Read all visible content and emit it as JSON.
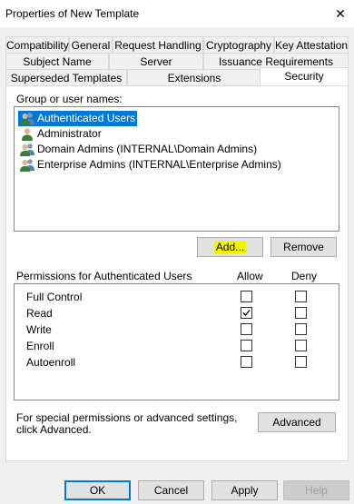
{
  "window": {
    "title": "Properties of New Template",
    "close_glyph": "✕"
  },
  "tabs": {
    "row1": [
      "Compatibility",
      "General",
      "Request Handling",
      "Cryptography",
      "Key Attestation"
    ],
    "row2": [
      "Subject Name",
      "Server",
      "Issuance Requirements"
    ],
    "row3": [
      "Superseded Templates",
      "Extensions",
      "Security"
    ],
    "active": "Security"
  },
  "security": {
    "group_label": "Group or user names:",
    "users": [
      {
        "name": "Authenticated Users",
        "icon": "users-group-icon",
        "selected": true
      },
      {
        "name": "Administrator",
        "icon": "user-icon",
        "selected": false
      },
      {
        "name": "Domain Admins (INTERNAL\\Domain Admins)",
        "icon": "users-group-icon",
        "selected": false
      },
      {
        "name": "Enterprise Admins (INTERNAL\\Enterprise Admins)",
        "icon": "users-group-icon",
        "selected": false
      }
    ],
    "add_label": "Add...",
    "remove_label": "Remove",
    "permissions_label": "Permissions for Authenticated Users",
    "allow_header": "Allow",
    "deny_header": "Deny",
    "permissions": [
      {
        "name": "Full Control",
        "allow": false,
        "deny": false
      },
      {
        "name": "Read",
        "allow": true,
        "deny": false
      },
      {
        "name": "Write",
        "allow": false,
        "deny": false
      },
      {
        "name": "Enroll",
        "allow": false,
        "deny": false
      },
      {
        "name": "Autoenroll",
        "allow": false,
        "deny": false
      }
    ],
    "advanced_text": "For special permissions or advanced settings, click Advanced.",
    "advanced_label": "Advanced"
  },
  "footer": {
    "ok": "OK",
    "cancel": "Cancel",
    "apply": "Apply",
    "help": "Help"
  },
  "colors": {
    "selection": "#0078d7",
    "highlight": "#f5f500",
    "dialog_bg": "#f0f0f0"
  }
}
